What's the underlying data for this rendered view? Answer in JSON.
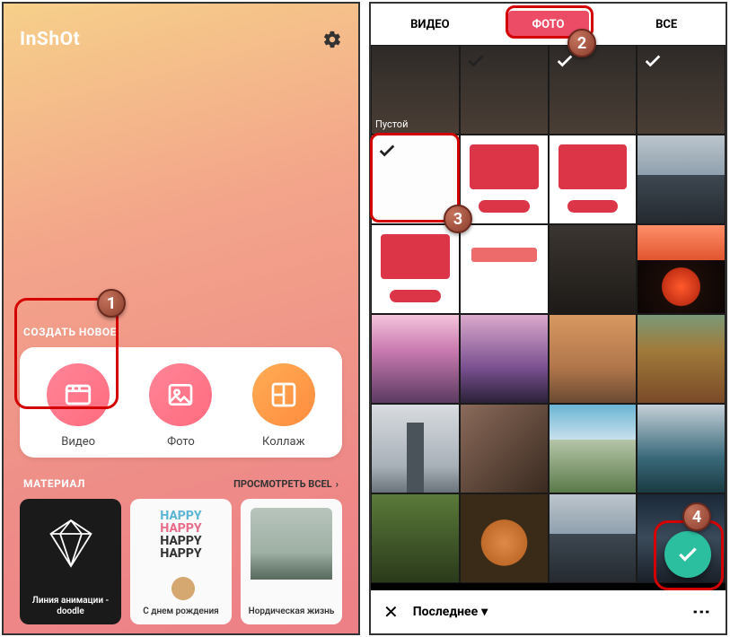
{
  "left": {
    "logo": "InShOt",
    "create_section": "СОЗДАТЬ НОВОЕ",
    "items": {
      "video": "Видео",
      "photo": "Фото",
      "collage": "Коллаж"
    },
    "material_section": "МАТЕРИАЛ",
    "view_all": "ПРОСМОТРЕТЬ ВСЕL",
    "materials": {
      "doodle": "Линия анимации - doodle",
      "birthday": "С днем рождения",
      "nordic": "Нордическая жизнь"
    }
  },
  "right": {
    "tabs": {
      "video": "ВИДЕО",
      "photo": "ФОТО",
      "all": "ВСЕ"
    },
    "empty_label": "Пустой",
    "bottom": {
      "recent": "Последнее"
    }
  },
  "steps": {
    "s1": "1",
    "s2": "2",
    "s3": "3",
    "s4": "4"
  }
}
